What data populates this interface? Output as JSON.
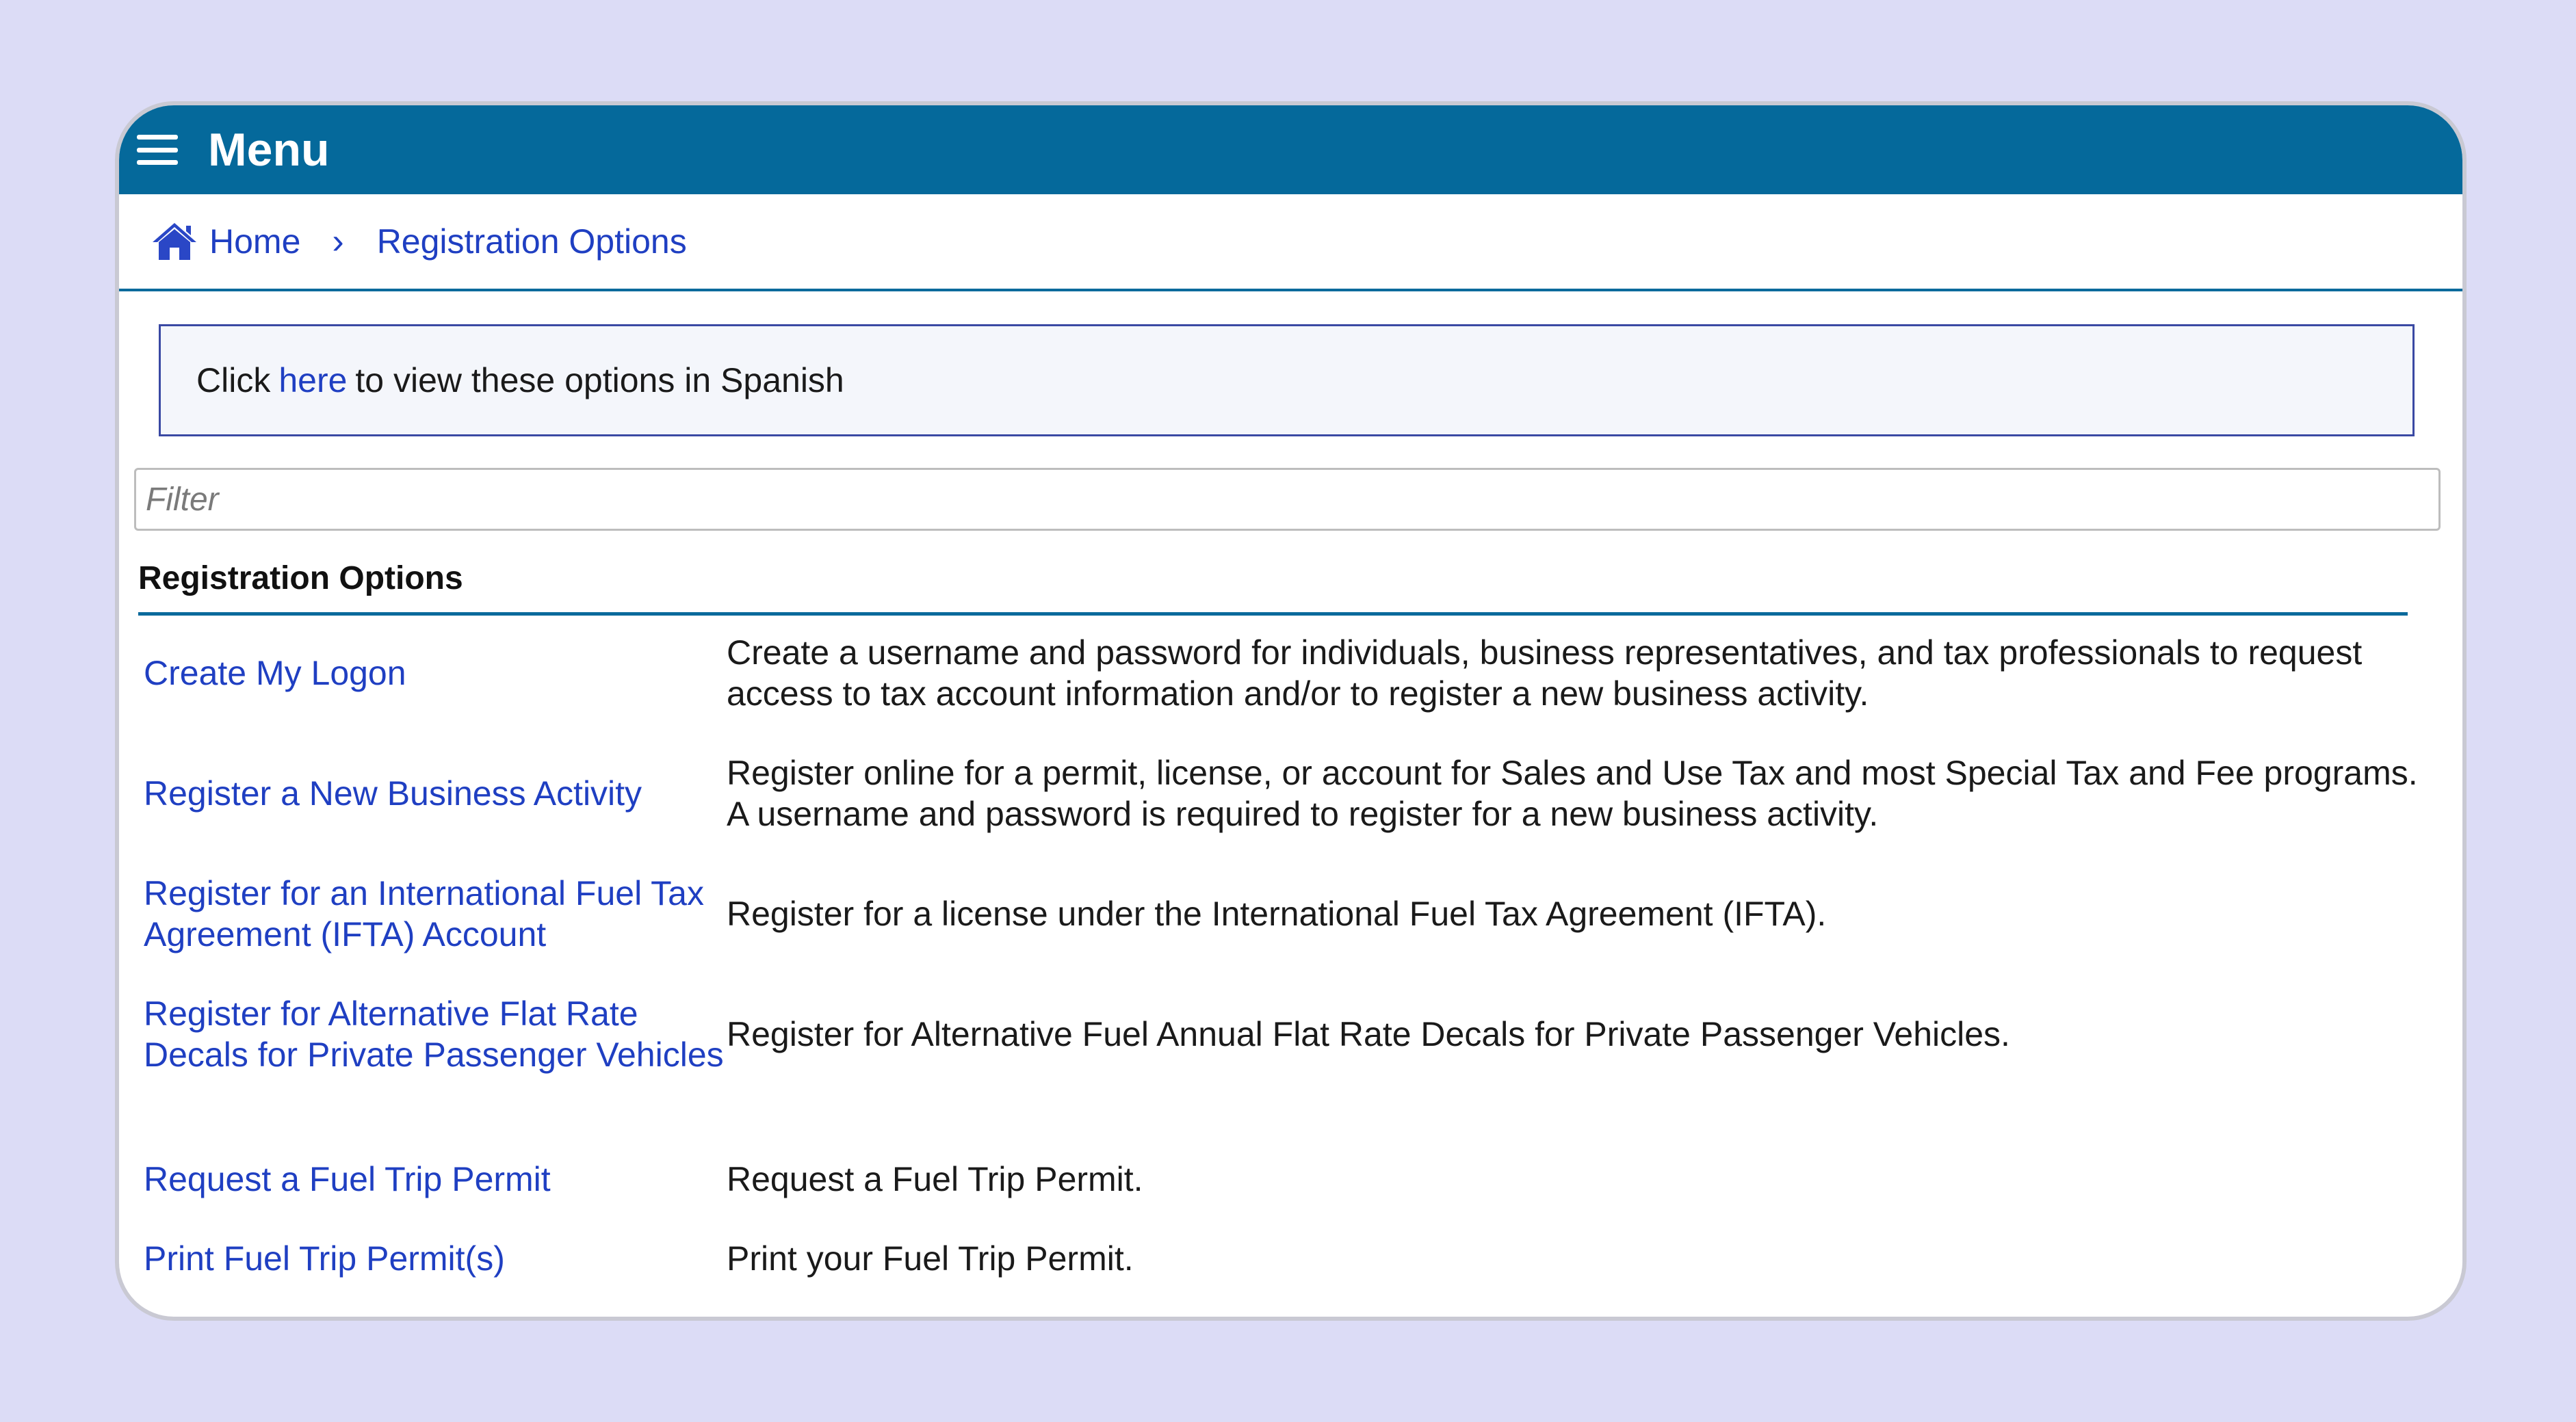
{
  "menu": {
    "title": "Menu"
  },
  "breadcrumb": {
    "home": "Home",
    "separator": "›",
    "current": "Registration Options"
  },
  "notice": {
    "prefix": "Click",
    "link": "here",
    "suffix": "to view these options in Spanish"
  },
  "filter": {
    "placeholder": "Filter",
    "value": ""
  },
  "section": {
    "title": "Registration Options"
  },
  "options": [
    {
      "label": "Create My Logon",
      "description": "Create a username and password for individuals, business representatives, and tax professionals to request access to tax account information and/or to register a new business activity."
    },
    {
      "label": "Register a New Business Activity",
      "description": "Register online for a permit, license, or account for Sales and Use Tax and most Special Tax and Fee programs. A username and password is required to register for a new business activity."
    },
    {
      "label": "Register for an International Fuel Tax Agreement (IFTA) Account",
      "description": "Register for a license under the International Fuel Tax Agreement (IFTA)."
    },
    {
      "label": "Register for Alternative Flat Rate Decals for Private Passenger Vehicles",
      "description": "Register for Alternative Fuel Annual Flat Rate Decals for Private Passenger Vehicles."
    },
    {
      "label": "Request a Fuel Trip Permit",
      "description": "Request a Fuel Trip Permit."
    },
    {
      "label": "Print Fuel Trip Permit(s)",
      "description": "Print your Fuel Trip Permit."
    }
  ],
  "colors": {
    "menu_bar": "#05699b",
    "link": "#1f3fc2",
    "background": "#dcdcf6"
  }
}
